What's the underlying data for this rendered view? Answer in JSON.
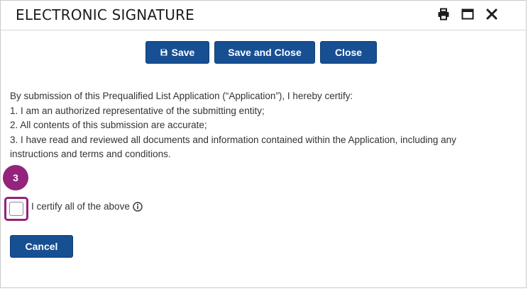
{
  "dialog": {
    "title": "ELECTRONIC SIGNATURE",
    "icons": [
      "print-icon",
      "maximize-icon",
      "close-icon"
    ]
  },
  "toolbar": {
    "save_label": "Save",
    "save_close_label": "Save and Close",
    "close_label": "Close"
  },
  "certification": {
    "lines": [
      "By submission of this Prequalified List Application (“Application”), I hereby certify:",
      "1. I am an authorized representative of the submitting entity;",
      "2. All contents of this submission are accurate;",
      "3. I have read and reviewed all documents and information contained within the Application, including any",
      "instructions and terms and conditions."
    ],
    "step_number": "3",
    "checkbox_label": "I certify all of the above",
    "checked": false
  },
  "footer": {
    "cancel_label": "Cancel"
  },
  "colors": {
    "primary_button": "#174f93",
    "highlight": "#93237b"
  }
}
